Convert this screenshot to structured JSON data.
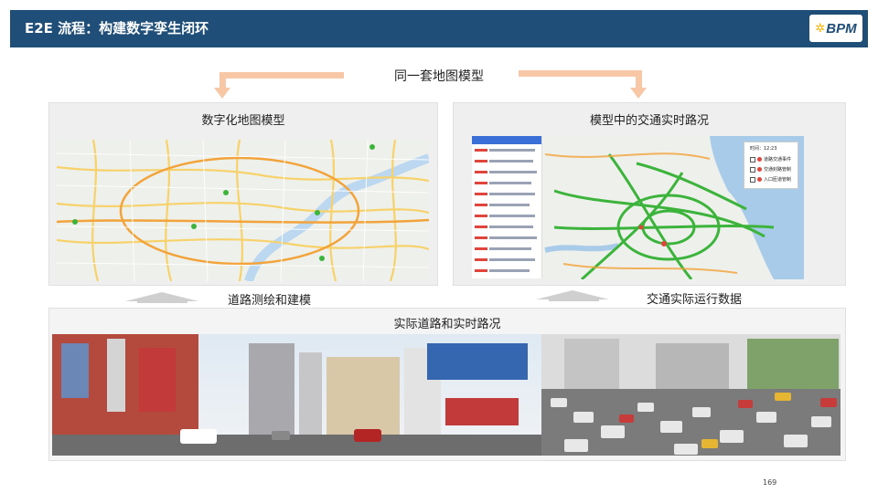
{
  "header": {
    "title": "E2E 流程：构建数字孪生闭环",
    "logo_text": "BPM",
    "logo_mark": "✲"
  },
  "top_label": "同一套地图模型",
  "panels": {
    "left_title": "数字化地图模型",
    "right_title": "模型中的交通实时路况",
    "bottom_title": "实际道路和实时路况"
  },
  "arrows": {
    "left_label": "道路测绘和建模",
    "right_label": "交通实际运行数据"
  },
  "traffic_legend": {
    "header": "时间：12:23",
    "items": [
      "道路交通事件",
      "交通封路管制",
      "入口匝道管制"
    ]
  },
  "page_number": "169",
  "colors": {
    "header_bg": "#1f4e79",
    "arrow_orange": "#f7c7a6",
    "arrow_gray": "#cfcfcf",
    "traffic_green": "#3cb43c"
  }
}
